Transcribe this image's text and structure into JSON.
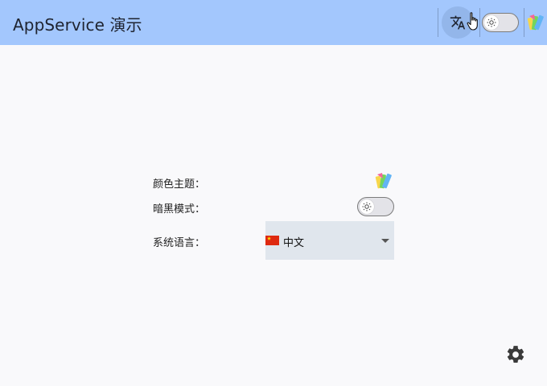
{
  "appbar": {
    "title": "AppService 演示",
    "translate_icon": "translate-icon",
    "dark_mode_toggle": {
      "checked": false,
      "knob_icon": "sun-icon"
    },
    "theme_icon": "rainbow-palette-icon"
  },
  "settings": {
    "color_theme": {
      "label": "颜色主题：",
      "icon": "rainbow-palette-icon"
    },
    "dark_mode": {
      "label": "暗黑模式：",
      "checked": false,
      "knob_icon": "sun-icon"
    },
    "language": {
      "label": "系统语言：",
      "selected": "中文",
      "flag": "china-flag-icon"
    }
  },
  "fab": {
    "icon": "gear-icon"
  },
  "colors": {
    "appbar_bg": "#a3c7fd",
    "page_bg": "#f9f9fb",
    "select_bg": "#e0e6ed"
  }
}
